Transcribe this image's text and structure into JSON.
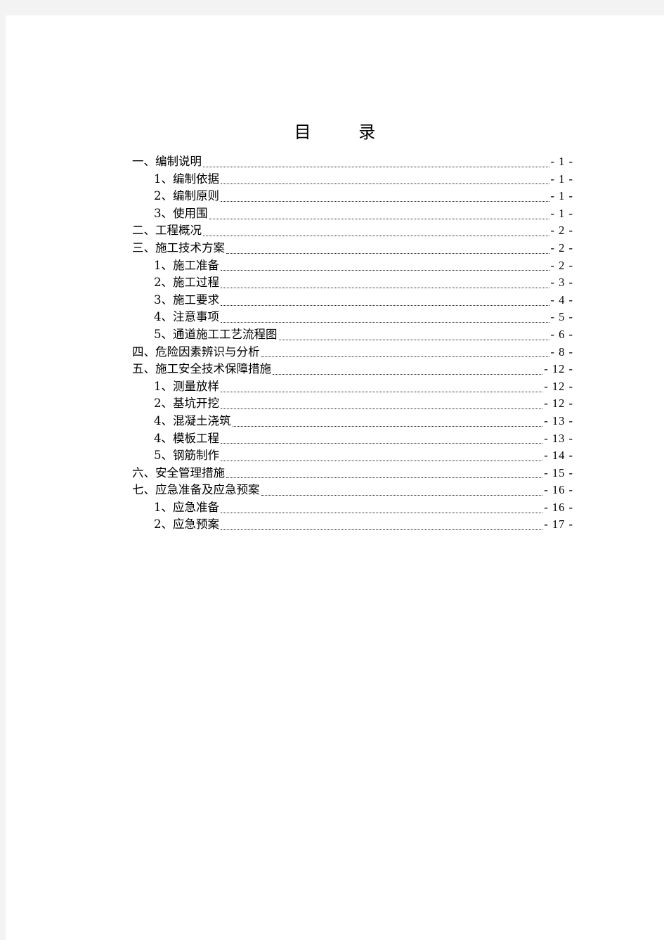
{
  "document": {
    "title": "目    录",
    "toc": [
      {
        "level": 1,
        "label": "一、编制说明",
        "page": "- 1 -"
      },
      {
        "level": 2,
        "label": "1、编制依据",
        "page": "- 1 -"
      },
      {
        "level": 2,
        "label": "2、编制原则",
        "page": "- 1 -"
      },
      {
        "level": 2,
        "label": "3、使用围",
        "page": "- 1 -"
      },
      {
        "level": 1,
        "label": "二、工程概况",
        "page": "- 2 -"
      },
      {
        "level": 1,
        "label": "三、施工技术方案",
        "page": "- 2 -"
      },
      {
        "level": 2,
        "label": "1、施工准备",
        "page": "- 2 -"
      },
      {
        "level": 2,
        "label": "2、施工过程",
        "page": "- 3 -"
      },
      {
        "level": 2,
        "label": "3、施工要求",
        "page": "- 4 -"
      },
      {
        "level": 2,
        "label": "4、注意事项",
        "page": "- 5 -"
      },
      {
        "level": 2,
        "label": "5、通道施工工艺流程图",
        "page": "- 6 -"
      },
      {
        "level": 1,
        "label": "四、危险因素辨识与分析",
        "page": "- 8 -"
      },
      {
        "level": 1,
        "label": "五、施工安全技术保障措施",
        "page": "- 12 -"
      },
      {
        "level": 2,
        "label": "1、测量放样",
        "page": "- 12 -"
      },
      {
        "level": 2,
        "label": "2、基坑开挖",
        "page": "- 12 -"
      },
      {
        "level": 2,
        "label": "4、混凝土浇筑",
        "page": "- 13 -"
      },
      {
        "level": 2,
        "label": "4、模板工程",
        "page": "- 13 -"
      },
      {
        "level": 2,
        "label": "5、钢筋制作",
        "page": "- 14 -"
      },
      {
        "level": 1,
        "label": "六、安全管理措施",
        "page": "- 15 -"
      },
      {
        "level": 1,
        "label": "七、应急准备及应急预案",
        "page": "- 16 -"
      },
      {
        "level": 2,
        "label": "1、应急准备",
        "page": "- 16 -"
      },
      {
        "level": 2,
        "label": "2、应急预案",
        "page": "- 17 -"
      }
    ]
  }
}
